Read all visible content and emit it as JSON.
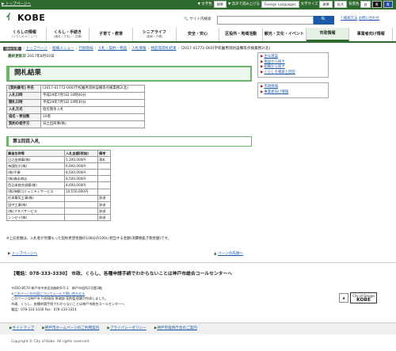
{
  "topbar": {
    "skip_link": "▶ トップページへ",
    "utilities": [
      "▼ 文字色",
      "標準",
      "▼ 音声で読み上げる",
      "Foreign Languages",
      "文字サイズ",
      "標準",
      "拡大",
      "背景色",
      "白",
      "黒",
      "青"
    ]
  },
  "header": {
    "logo_text": "KOBE",
    "search_label": "🔍 サイト内検索",
    "search_button": "🔍",
    "links": [
      "? 検索方法",
      "お問い合わせ"
    ]
  },
  "nav": [
    {
      "label": "くらしの情報",
      "sub": "(くらしのメニュー)"
    },
    {
      "label": "くらし・手続き",
      "sub": "(届出・すまい・交通)"
    },
    {
      "label": "子育て・教育",
      "sub": ""
    },
    {
      "label": "シニアライフ",
      "sub": "(高齢・介護)"
    },
    {
      "label": "安全・安心",
      "sub": ""
    },
    {
      "label": "区役所・地域活動",
      "sub": ""
    },
    {
      "label": "観光・文化・イベント",
      "sub": ""
    },
    {
      "label": "市政情報",
      "sub": ""
    },
    {
      "label": "事業者向け情報",
      "sub": ""
    }
  ],
  "breadcrumb": {
    "here": "現在位置",
    "items": [
      "トップページ",
      "組織メニュー",
      "行財政局",
      "入札・契約・物品",
      "入札情報",
      "物品等開札結果",
      "[2017-01772-000]学校園用消防設備等点検業務2(北)"
    ]
  },
  "updated": {
    "label": "最終更新日",
    "value": "2017年8月10日"
  },
  "page_title": "開札結果",
  "info": [
    {
      "k": "[契約番号] 件名",
      "v": "[2017-01772-000]学校園用消防設備等点検業務2(北)"
    },
    {
      "k": "入札日時",
      "v": "平成29年7月5日 10時00分"
    },
    {
      "k": "開札日時",
      "v": "平成29年7月5日 10時30分"
    },
    {
      "k": "入札方式",
      "v": "指名競争入札"
    },
    {
      "k": "指名・参加数",
      "v": "10者"
    },
    {
      "k": "契約の相手方",
      "v": "日之出商事(株)"
    }
  ],
  "round_title": "第1回目入札",
  "bid_table": {
    "headers": [
      "業者名称等",
      "入札金額(税抜)",
      "備考"
    ],
    "rows": [
      [
        "日之出商事(株)",
        "5,290,000円",
        "落札"
      ],
      [
        "帝国防災(株)",
        "6,000,000円",
        ""
      ],
      [
        "(株)平康",
        "8,500,000円",
        ""
      ],
      [
        "(株)森永商店",
        "8,500,000円",
        ""
      ],
      [
        "西日本総合設備(株)",
        "8,600,000円",
        ""
      ],
      [
        "(株)神鋼コミュニティサービス",
        "10,550,000円",
        ""
      ],
      [
        "杉本電気工事(株)",
        "",
        "辞退"
      ],
      [
        "田中工業(株)",
        "",
        "辞退"
      ],
      [
        "(株)フタバサービス",
        "",
        "辞退"
      ],
      [
        "シンセイ(株)",
        "",
        "辞退"
      ]
    ]
  },
  "note": "※上記金額は、入札者が見積もった契約希望金額の108分の100に相当する金額(消費税抜き税金額)です。",
  "page_top": "トップページへ",
  "back_link": "ページの先頭へ",
  "sidebar": {
    "box1": [
      "主な施設",
      "施設から探す",
      "組織から探す",
      "くらしを検索と回答"
    ],
    "box2": [
      "市政情報",
      "事業者向け情報"
    ]
  },
  "footer": {
    "call_label": "【電話：078-333-3330】",
    "call_text": "市政、くらし、各種申請手続でわからないことは神戸市総合コールセンターへ",
    "address": [
      "〒650-8570 神戸市中央区加納町6-5-1　神戸市役所1号館3階",
      "このページの内容についてメールで問い合わせる",
      "このページは神戸市 行財政局 財政部 契約監理課が作成しました。",
      "市政、くらし、各種申請手続でわからないことは神戸市総合コールセンターへ",
      "電話：078-333-3330 Fax：078-333-3314"
    ],
    "logo_city": "City of Design",
    "logo_kobe": "KOBE",
    "links": [
      "サイトマップ",
      "神戸市ホームページのご利用案内",
      "プライバシーポリシー",
      "神戸市役所庁舎のご案内"
    ],
    "copyright": "Copyright © City of Kobe. All rights reserved."
  }
}
